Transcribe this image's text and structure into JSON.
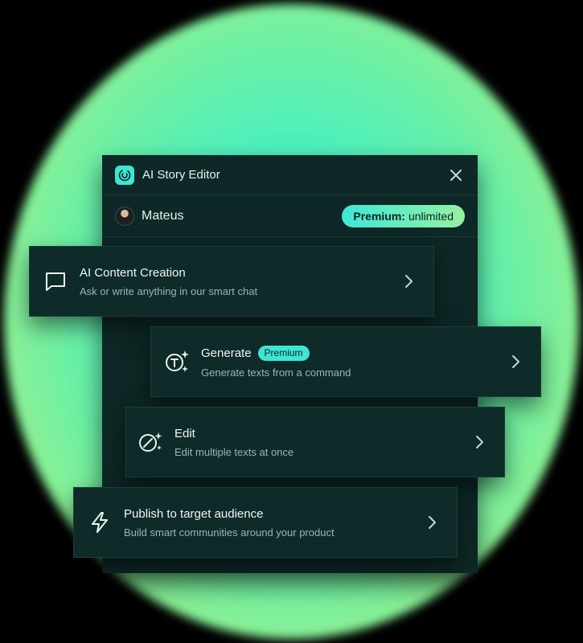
{
  "window": {
    "title": "AI Story Editor",
    "logo_icon": "swirl-logo-icon",
    "close_icon": "close-icon"
  },
  "user": {
    "name": "Mateus",
    "plan_label": "Premium:",
    "plan_value": "unlimited"
  },
  "cards": [
    {
      "title": "AI Content Creation",
      "description": "Ask or write anything in our smart chat",
      "icon": "chat-bubble-icon"
    },
    {
      "title": "Generate",
      "badge": "Premium",
      "description": "Generate texts from a command",
      "icon": "text-sparkle-icon"
    },
    {
      "title": "Edit",
      "description": "Edit multiple texts at once",
      "icon": "edit-sparkle-icon"
    },
    {
      "title": "Publish to target audience",
      "description": "Build smart communities around your product",
      "icon": "lightning-icon"
    }
  ],
  "colors": {
    "accent": "#3ee6d2",
    "panel": "#0d2826",
    "card": "#0e2b29",
    "glow_green": "#8cf094"
  }
}
